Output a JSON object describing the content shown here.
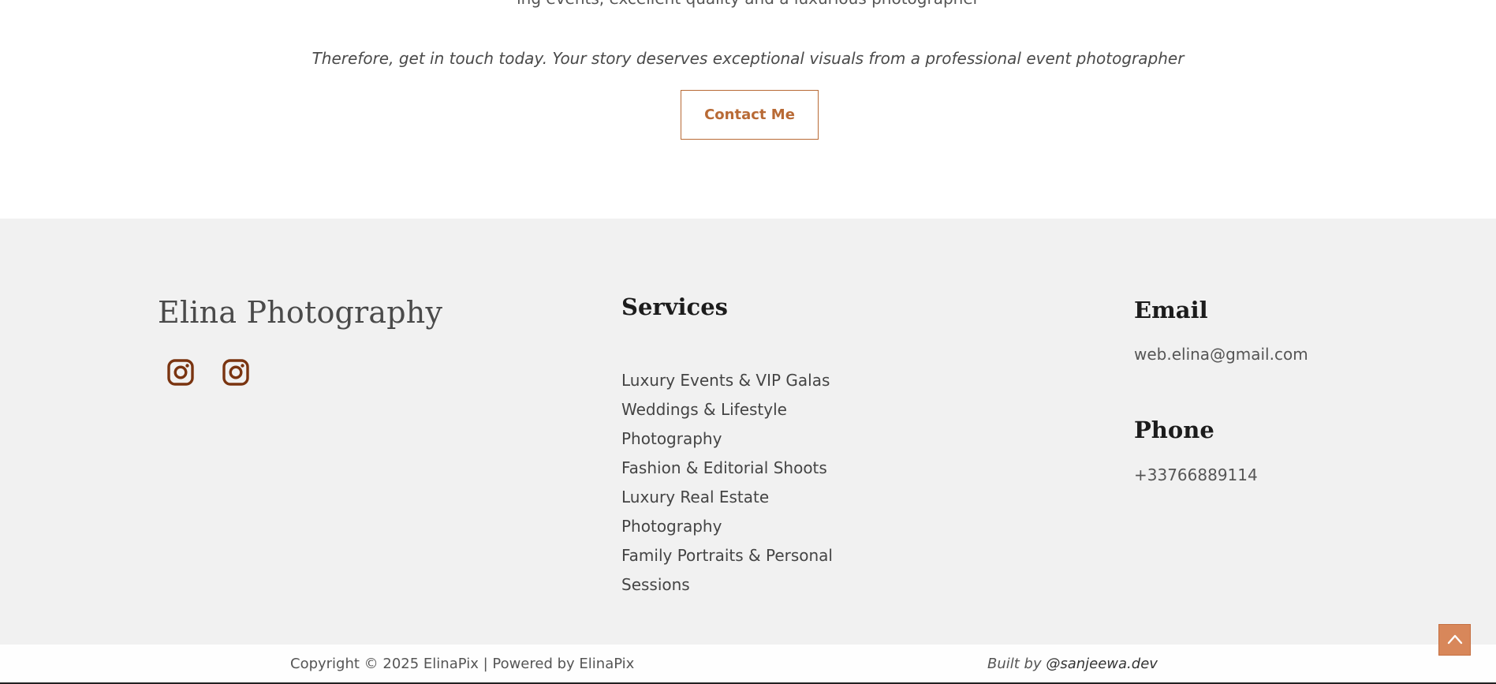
{
  "cta": {
    "cut_text": "ing events, excellent quality and a luxurious photographer",
    "tagline": "Therefore, get in touch today. Your story deserves exceptional visuals from a professional event photographer",
    "button_label": "Contact Me"
  },
  "footer": {
    "brand": "Elina Photography",
    "social": [
      {
        "icon": "instagram-icon"
      },
      {
        "icon": "instagram-icon"
      }
    ],
    "services": {
      "heading": "Services",
      "items": [
        "Luxury Events & VIP Galas",
        "Weddings & Lifestyle Photography",
        "Fashion & Editorial Shoots",
        "Luxury Real Estate Photography",
        "Family Portraits & Personal Sessions"
      ]
    },
    "email": {
      "heading": "Email",
      "value": "web.elina@gmail.com"
    },
    "phone": {
      "heading": "Phone",
      "value": "+33766889114"
    }
  },
  "bottom_bar": {
    "copyright": "Copyright © 2025 ElinaPix | Powered by ElinaPix",
    "built_by_prefix": "Built by ",
    "built_by_handle": "@sanjeewa.dev"
  },
  "scroll_top": {
    "icon": "chevron-up-icon"
  },
  "colors": {
    "accent": "#b86a35",
    "icon_brown": "#7a3410",
    "scroll_button": "#d8875a",
    "footer_bg": "#f1f1f1"
  }
}
